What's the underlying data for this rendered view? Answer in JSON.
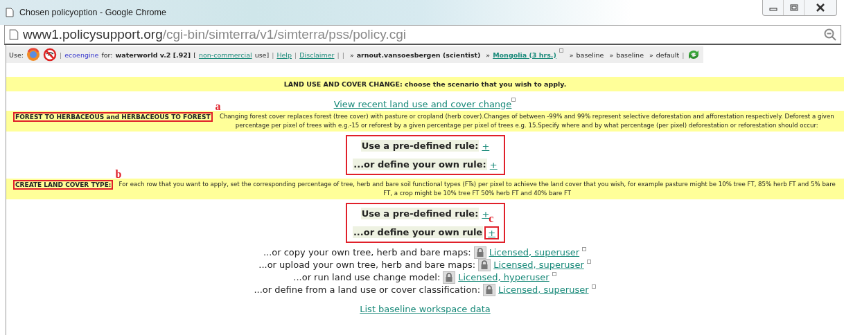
{
  "window": {
    "title": "Chosen policyoption - Google Chrome"
  },
  "address_bar": {
    "domain": "www1.policysupport.org",
    "path": "/cgi-bin/simterra/v1/simterra/pss/policy.cgi"
  },
  "toolbar": {
    "use_label": "Use:",
    "items": [
      {
        "kind": "sep",
        "text": "|"
      },
      {
        "kind": "brand",
        "text": "ecoengine"
      },
      {
        "kind": "text",
        "text": "for:"
      },
      {
        "kind": "bold",
        "text": "waterworld v.2 [.92]"
      },
      {
        "kind": "text",
        "text": "["
      },
      {
        "kind": "link",
        "text": "non-commercial"
      },
      {
        "kind": "text",
        "text": "use]"
      },
      {
        "kind": "sep",
        "text": "|"
      },
      {
        "kind": "link",
        "text": "Help"
      },
      {
        "kind": "sep",
        "text": "|"
      },
      {
        "kind": "link",
        "text": "Disclaimer"
      },
      {
        "kind": "sep",
        "text": "|"
      },
      {
        "kind": "sep",
        "text": "|"
      },
      {
        "kind": "crumb",
        "text": "»"
      },
      {
        "kind": "bold",
        "text": "arnout.vansoesbergen (scientist)"
      },
      {
        "kind": "crumb",
        "text": "»"
      },
      {
        "kind": "boldlink",
        "text": "Mongolia (3 hrs.)"
      },
      {
        "kind": "crumb",
        "text": "»"
      },
      {
        "kind": "text",
        "text": "baseline"
      },
      {
        "kind": "crumb",
        "text": "»"
      },
      {
        "kind": "text",
        "text": "baseline"
      },
      {
        "kind": "crumb",
        "text": "»"
      },
      {
        "kind": "text",
        "text": "default"
      },
      {
        "kind": "sep",
        "text": "|"
      }
    ]
  },
  "header": "LAND USE AND COVER CHANGE: choose the scenario that you wish to apply.",
  "view_link": "View recent land use and cover change",
  "sections": [
    {
      "title": "FOREST TO HERBACEOUS and HERBACEOUS TO FOREST",
      "annotation": "a",
      "description": "Changing forest cover replaces forest (tree cover) with pasture or cropland (herb cover).Changes of between -99% and 99% represent selective deforestation and afforestation respectively. Deforest a given percentage per pixel of trees with e.g.-15 or reforest by a given percentage per pixel of trees e.g. 15.Specify where and by what percentage (per pixel) deforestation or reforestation should occur:",
      "rules": [
        {
          "label": "Use a pre-defined rule:",
          "link": "+"
        },
        {
          "label": "...or define your own rule:",
          "link": "+"
        }
      ]
    },
    {
      "title": "CREATE LAND COVER TYPE:",
      "annotation": "b",
      "description": "For each row that you want to apply, set the corresponding percentage of tree, herb and bare soil functional types (FTs) per pixel to achieve the land cover that you wish, for example pasture might be 10% tree FT, 85% herb FT and 5% bare FT, a crop might be 10% tree FT 50% herb FT and 40% bare FT",
      "rules": [
        {
          "label": "Use a pre-defined rule:",
          "link": "+"
        },
        {
          "label": "...or define your own rule",
          "link": "+",
          "annotation": "c"
        }
      ]
    }
  ],
  "options": [
    {
      "label": "...or copy your own tree, herb and bare maps:",
      "link": "Licensed, superuser"
    },
    {
      "label": "...or upload your own tree, herb and bare maps:",
      "link": "Licensed, superuser"
    },
    {
      "label": "...or run land use change model:",
      "link": "Licensed, hyperuser"
    },
    {
      "label": "...or define from a land use or cover classification:",
      "link": "Licensed, superuser"
    }
  ],
  "footer_link": "List baseline workspace data"
}
